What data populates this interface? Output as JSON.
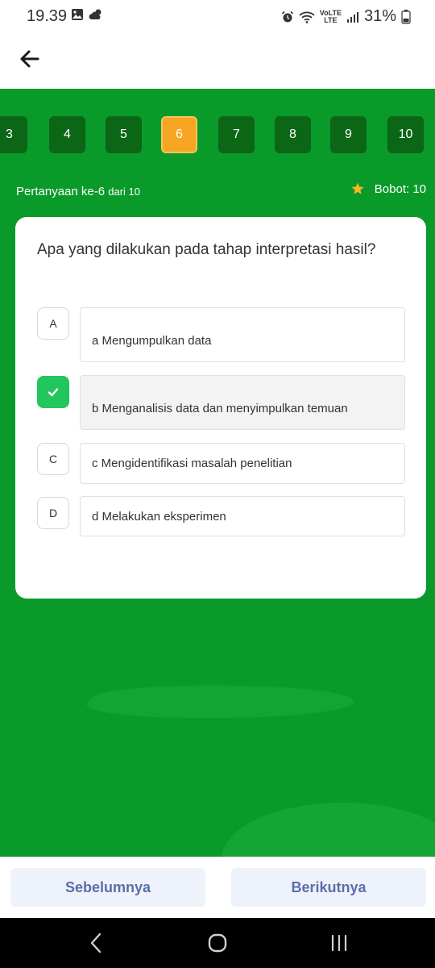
{
  "status": {
    "time": "19.39",
    "battery": "31%",
    "network_label": "LTE",
    "volte_label": "VoLTE",
    "icons": [
      "image-icon",
      "weather-icon",
      "alarm-icon",
      "wifi-icon",
      "signal-icon",
      "battery-icon"
    ]
  },
  "header": {
    "back_icon": "arrow-left-icon"
  },
  "question_nav": {
    "numbers": [
      "3",
      "4",
      "5",
      "6",
      "7",
      "8",
      "9",
      "10"
    ],
    "active": "6"
  },
  "question": {
    "label": "Pertanyaan ke-6",
    "of": "dari 10",
    "weight": "Bobot: 10",
    "text": "Apa yang dilakukan pada tahap interpretasi hasil?"
  },
  "options": [
    {
      "letter": "A",
      "text": "a Mengumpulkan data"
    },
    {
      "letter": "B",
      "text": "b Menganalisis data dan menyimpulkan temuan",
      "selected": true
    },
    {
      "letter": "C",
      "text": "c Mengidentifikasi masalah penelitian"
    },
    {
      "letter": "D",
      "text": "d Melakukan eksperimen"
    }
  ],
  "footer": {
    "prev": "Sebelumnya",
    "next": "Berikutnya"
  },
  "colors": {
    "accent": "#0a9a2a",
    "active_number": "#f6a623",
    "number_bg": "#0b6616",
    "check": "#22c55e",
    "star": "#f6b51e"
  }
}
